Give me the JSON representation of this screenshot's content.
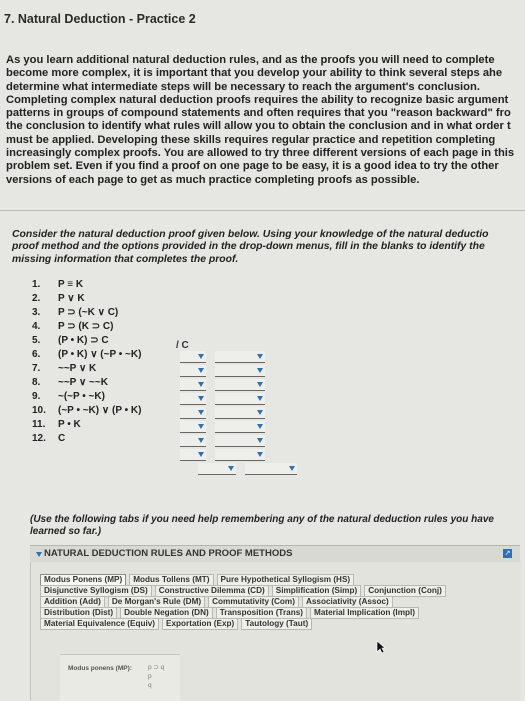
{
  "title": "7. Natural Deduction - Practice 2",
  "intro_lines": [
    "As you learn additional natural deduction rules, and as the proofs you will need to complete",
    "become more complex, it is important that you develop your ability to think several steps ahe",
    "determine what intermediate steps will be necessary to reach the argument's conclusion.",
    "Completing complex natural deduction proofs requires the ability to recognize basic argument",
    "patterns in groups of compound statements and often requires that you \"reason backward\" fro",
    "the conclusion to identify what rules will allow you to obtain the conclusion and in what order t",
    "must be applied. Developing these skills requires regular practice and repetition completing",
    "increasingly complex proofs. You are allowed to try three different versions of each page in this",
    "problem set. Even if you find a proof on one page to be easy, it is a good idea to try the other",
    "versions of each page to get as much practice completing proofs as possible."
  ],
  "task_lines": [
    "Consider the natural deduction proof given below. Using your knowledge of the natural deductio",
    "proof method and the options provided in the drop-down menus, fill in the blanks to identify the",
    "missing information that completes the proof."
  ],
  "proof_lines": [
    {
      "num": "1.",
      "formula": "P ≡ K"
    },
    {
      "num": "2.",
      "formula": "P ∨ K"
    },
    {
      "num": "3.",
      "formula": "P ⊃ (~K ∨ C)"
    },
    {
      "num": "4.",
      "formula": "P ⊃ (K ⊃ C)"
    },
    {
      "num": "5.",
      "formula": "(P • K) ⊃ C"
    },
    {
      "num": "6.",
      "formula": "(P • K) ∨ (~P • ~K)"
    },
    {
      "num": "7.",
      "formula": "~~P ∨ K"
    },
    {
      "num": "8.",
      "formula": "~~P ∨ ~~K"
    },
    {
      "num": "9.",
      "formula": "~(~P • ~K)"
    },
    {
      "num": "10.",
      "formula": "(~P • ~K) ∨ (P • K)"
    },
    {
      "num": "11.",
      "formula": "P • K"
    },
    {
      "num": "12.",
      "formula": "C"
    }
  ],
  "conclusion_marker": "/ C",
  "help_lines": [
    "(Use the following tabs if you need help remembering any of the natural deduction rules you have",
    "learned so far.)"
  ],
  "panel": {
    "label": "NATURAL DEDUCTION RULES AND PROOF METHODS",
    "tab_rows": [
      [
        "Modus Ponens (MP)",
        "Modus Tollens (MT)",
        "Pure Hypothetical Syllogism (HS)"
      ],
      [
        "Disjunctive Syllogism (DS)",
        "Constructive Dilemma (CD)",
        "Simplification (Simp)",
        "Conjunction (Conj)"
      ],
      [
        "Addition (Add)",
        "De Morgan's Rule (DM)",
        "Commutativity (Com)",
        "Associativity (Assoc)"
      ],
      [
        "Distribution (Dist)",
        "Double Negation (DN)",
        "Transposition (Trans)",
        "Material Implication (Impl)"
      ],
      [
        "Material Equivalence (Equiv)",
        "Exportation (Exp)",
        "Tautology (Taut)"
      ]
    ],
    "example_name": "Modus ponens (MP):",
    "example_rule": [
      "p ⊃ q",
      "p",
      "q"
    ]
  },
  "colors": {
    "accent": "#2e6fb5",
    "background": "#e6e6e2"
  }
}
